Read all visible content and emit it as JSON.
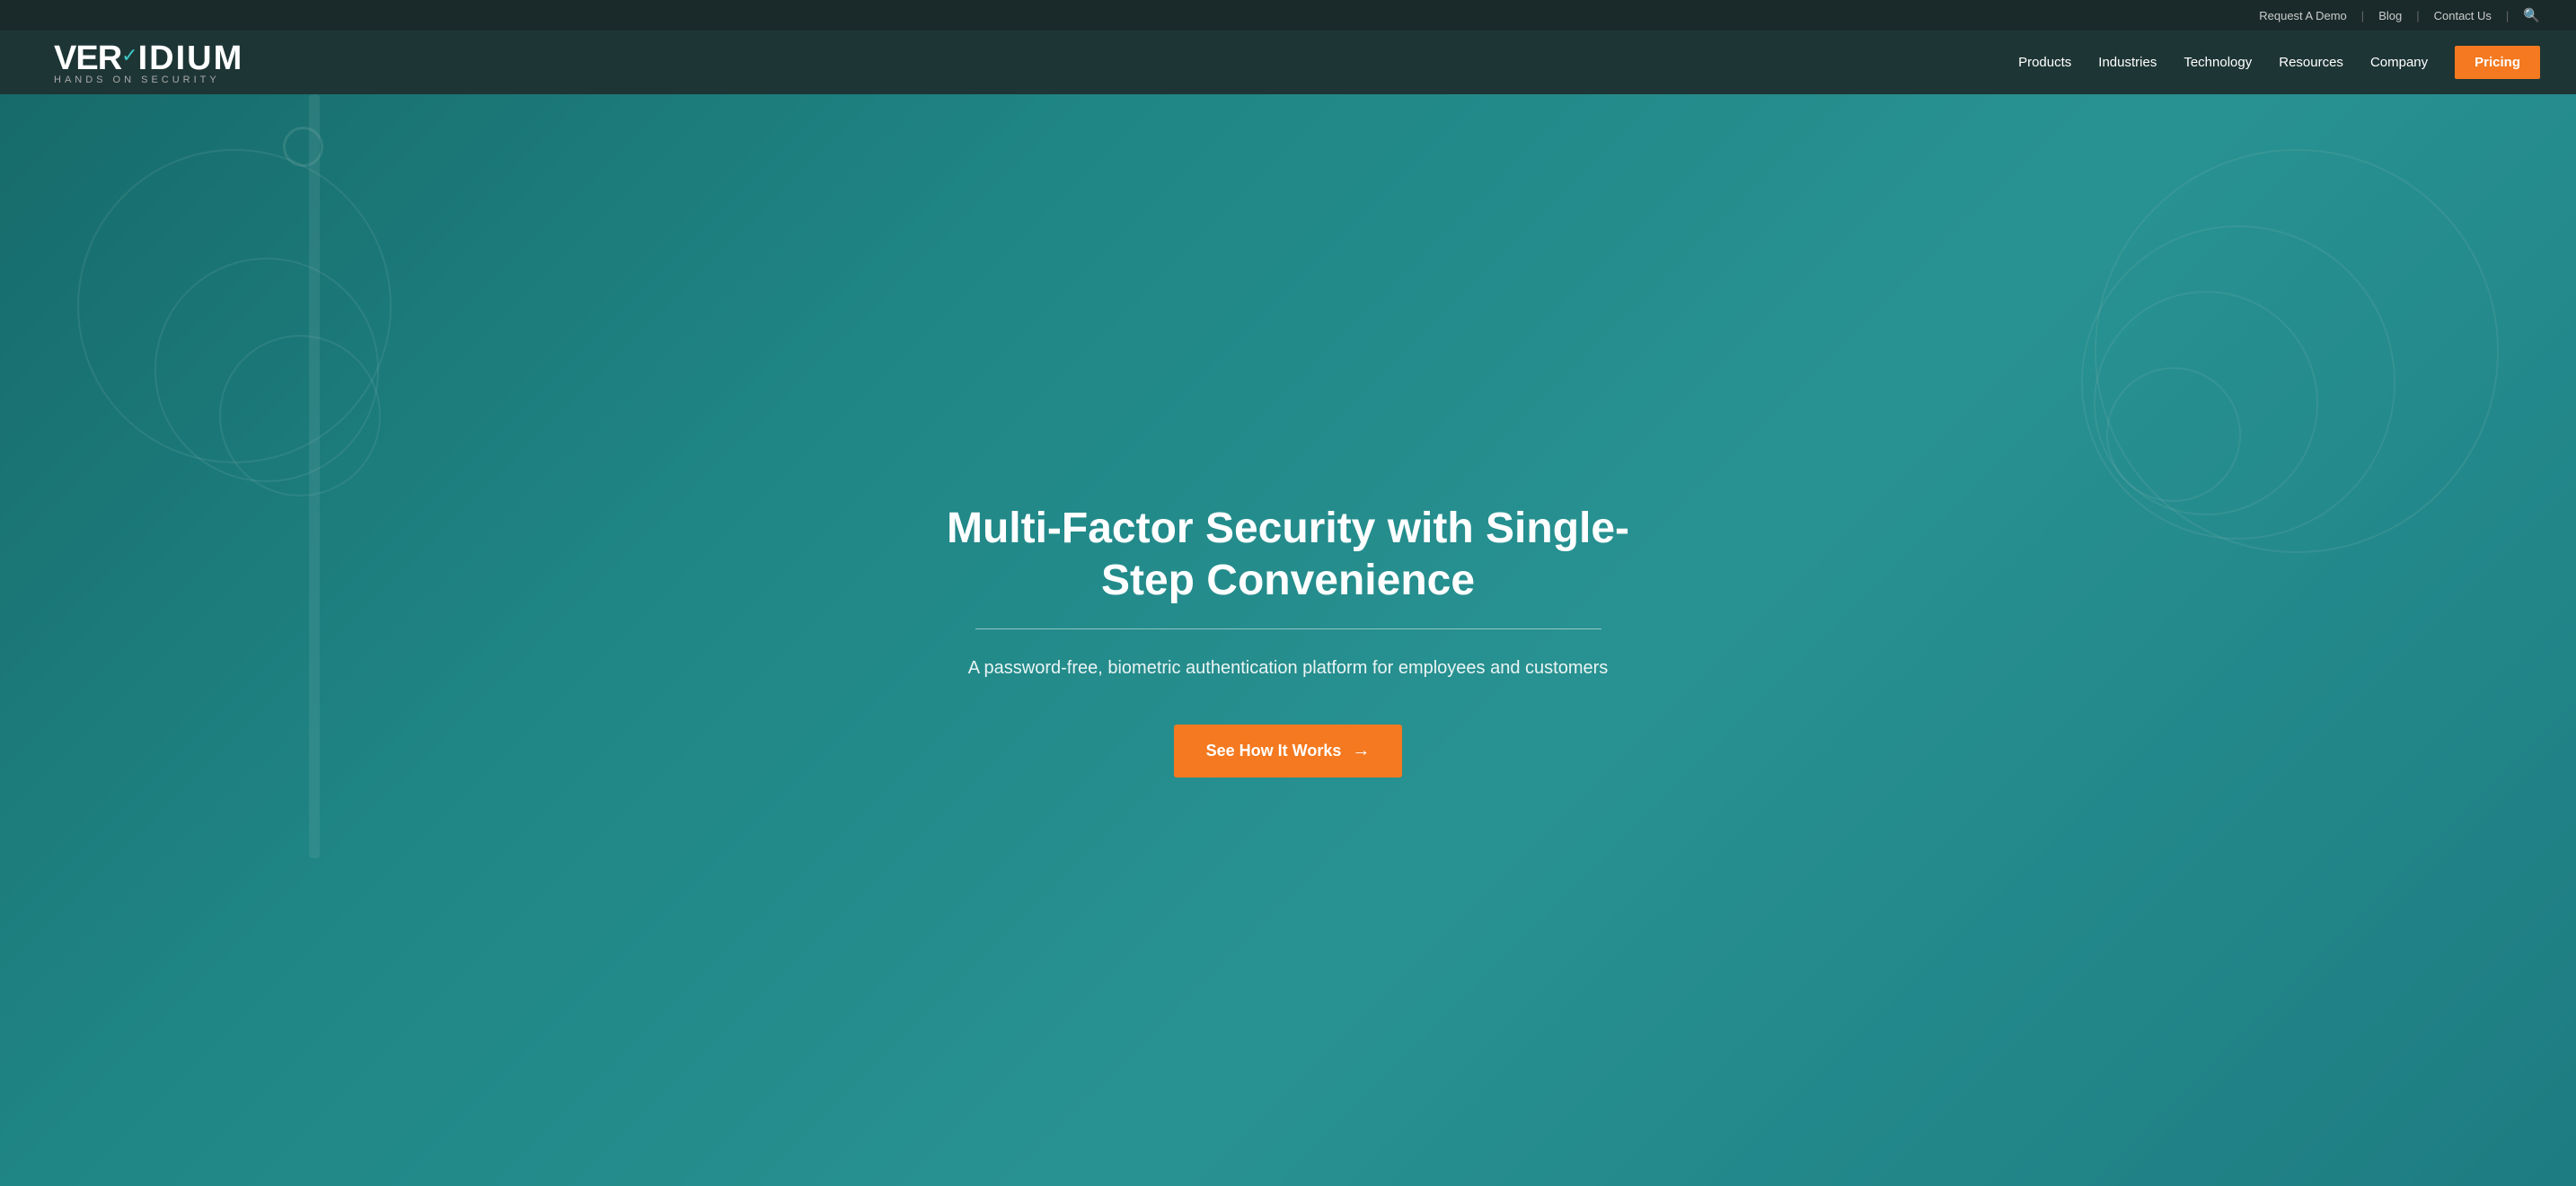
{
  "topbar": {
    "links": [
      {
        "label": "Request A Demo",
        "id": "request-demo"
      },
      {
        "label": "Blog",
        "id": "blog"
      },
      {
        "label": "Contact Us",
        "id": "contact"
      }
    ]
  },
  "logo": {
    "brand": "VERIDIUM",
    "tagline": "HANDS ON SECURITY",
    "check_symbol": "✓"
  },
  "nav": {
    "items": [
      {
        "label": "Products",
        "id": "products"
      },
      {
        "label": "Industries",
        "id": "industries"
      },
      {
        "label": "Technology",
        "id": "technology"
      },
      {
        "label": "Resources",
        "id": "resources"
      },
      {
        "label": "Company",
        "id": "company"
      }
    ],
    "cta": {
      "label": "Pricing",
      "id": "pricing"
    }
  },
  "hero": {
    "title": "Multi-Factor Security with Single-Step Convenience",
    "subtitle": "A password-free, biometric authentication platform for employees and customers",
    "cta_label": "See How It Works",
    "cta_arrow": "→"
  },
  "colors": {
    "accent_orange": "#f47920",
    "nav_bg": "#1e3535",
    "topbar_bg": "#1a2a2a",
    "hero_teal": "#2aa0a0",
    "teal_light": "#3ec8c8"
  }
}
